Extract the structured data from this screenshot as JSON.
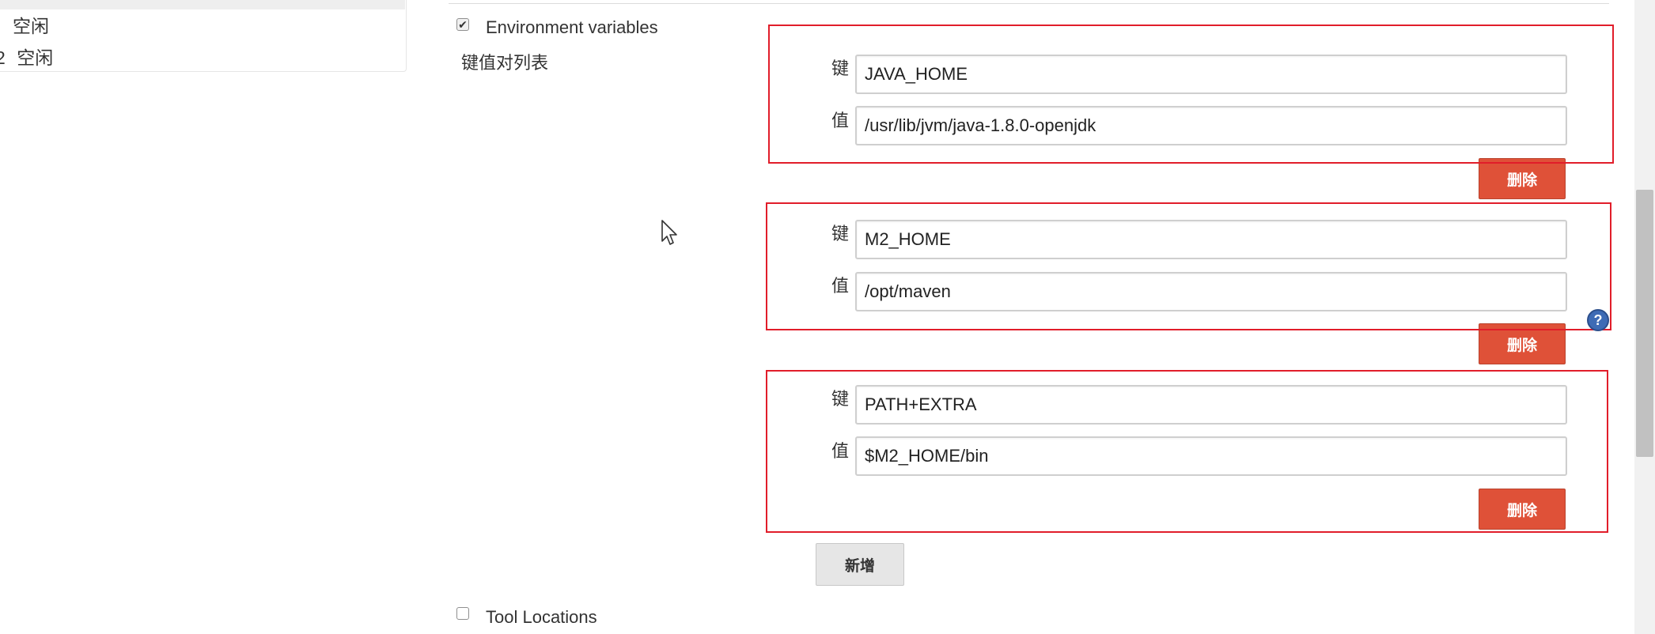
{
  "executors": {
    "items": [
      {
        "number": "",
        "status": "空闲"
      },
      {
        "number": "2",
        "status": "空闲"
      }
    ]
  },
  "env_vars": {
    "label": "Environment variables",
    "checked": true,
    "list_title": "键值对列表",
    "entries": [
      {
        "key_label": "键",
        "key": "JAVA_HOME",
        "value_label": "值",
        "value": "/usr/lib/jvm/java-1.8.0-openjdk",
        "delete_label": "删除"
      },
      {
        "key_label": "键",
        "key": "M2_HOME",
        "value_label": "值",
        "value": "/opt/maven",
        "delete_label": "删除"
      },
      {
        "key_label": "键",
        "key": "PATH+EXTRA",
        "value_label": "值",
        "value": "$M2_HOME/bin",
        "delete_label": "删除"
      }
    ],
    "add_label": "新增",
    "help_icon": "?"
  },
  "tool_locations": {
    "label": "Tool Locations",
    "checked": false
  },
  "colors": {
    "delete_button": "#df5138",
    "highlight_box": "#e11d2a",
    "help_icon": "#3e6bb5"
  },
  "icons": [
    "checkbox-checked-icon",
    "checkbox-unchecked-icon",
    "help-icon",
    "mouse-cursor-icon"
  ]
}
